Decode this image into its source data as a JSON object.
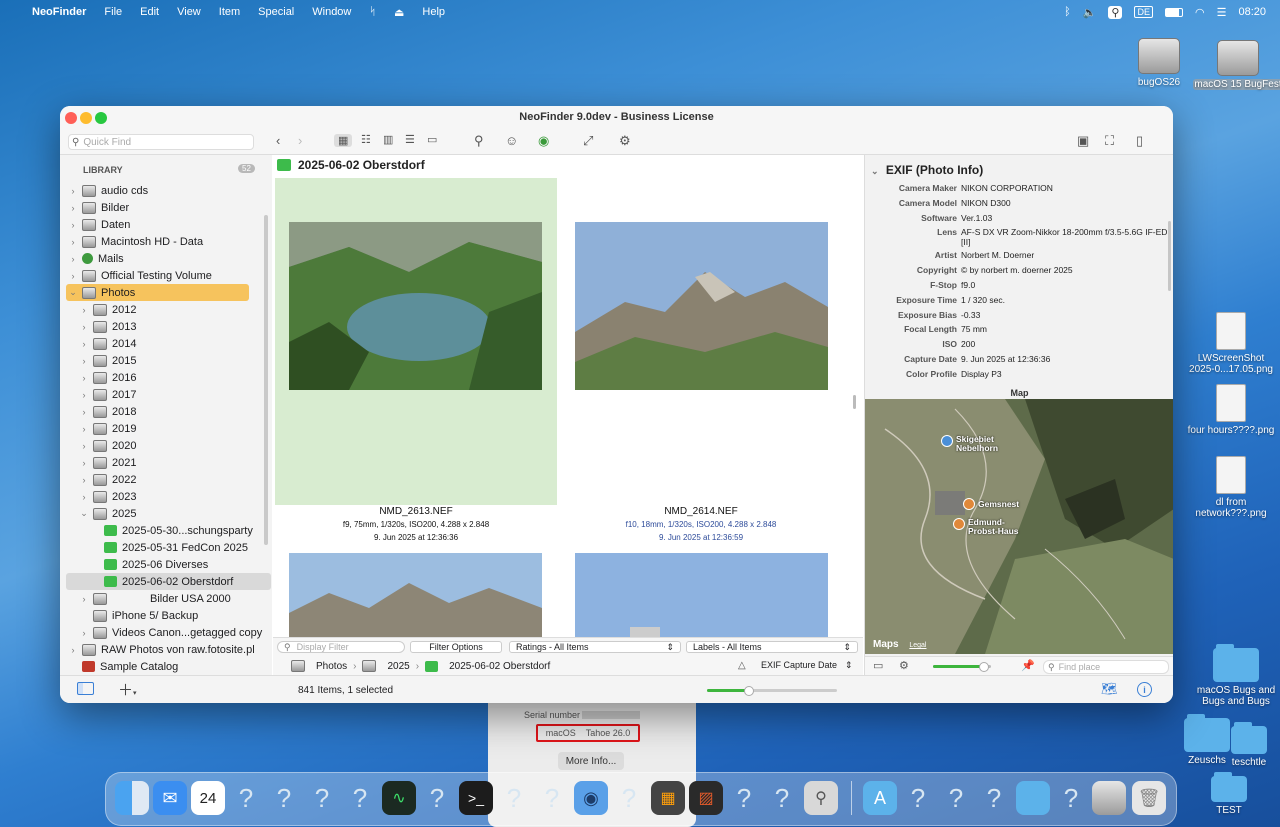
{
  "menubar": {
    "app": "NeoFinder",
    "items": [
      "File",
      "Edit",
      "View",
      "Item",
      "Special",
      "Window",
      "Help"
    ],
    "input_source": "DE",
    "clock": "08:20"
  },
  "desktop": {
    "icons": [
      {
        "label": "bugOS26",
        "type": "disk"
      },
      {
        "label": "macOS 15 BugFest",
        "type": "disk"
      },
      {
        "label": "LWScreenShot 2025-0...17.05.png",
        "type": "doc"
      },
      {
        "label": "four hours????.png",
        "type": "doc"
      },
      {
        "label": "dl from network???.png",
        "type": "doc"
      },
      {
        "label": "macOS Bugs and Bugs and Bugs",
        "type": "folder"
      },
      {
        "label": "Zeuschs",
        "type": "folder"
      },
      {
        "label": "teschtle",
        "type": "folder"
      },
      {
        "label": "TEST",
        "type": "folder"
      }
    ]
  },
  "about_window": {
    "serial_label": "Serial number",
    "macos_label": "macOS",
    "macos_version": "Tahoe 26.0",
    "more_info": "More Info..."
  },
  "window": {
    "title": "NeoFinder 9.0dev - Business License",
    "quick_find_placeholder": "Quick Find",
    "library_label": "LIBRARY",
    "library_count": "52",
    "sidebar": [
      {
        "label": "audio cds",
        "level": 0,
        "chev": "›",
        "icon": "disk"
      },
      {
        "label": "Bilder",
        "level": 0,
        "chev": "›",
        "icon": "disk"
      },
      {
        "label": "Daten",
        "level": 0,
        "chev": "›",
        "icon": "disk"
      },
      {
        "label": "Macintosh HD - Data",
        "level": 0,
        "chev": "›",
        "icon": "disk"
      },
      {
        "label": "Mails",
        "level": 0,
        "chev": "›",
        "icon": "mail"
      },
      {
        "label": "Official Testing Volume",
        "level": 0,
        "chev": "›",
        "icon": "disk"
      },
      {
        "label": "Photos",
        "level": 0,
        "chev": "⌄",
        "icon": "disk",
        "selected": "yes"
      },
      {
        "label": "2012",
        "level": 1,
        "chev": "›",
        "icon": "disk"
      },
      {
        "label": "2013",
        "level": 1,
        "chev": "›",
        "icon": "disk"
      },
      {
        "label": "2014",
        "level": 1,
        "chev": "›",
        "icon": "disk"
      },
      {
        "label": "2015",
        "level": 1,
        "chev": "›",
        "icon": "disk"
      },
      {
        "label": "2016",
        "level": 1,
        "chev": "›",
        "icon": "disk"
      },
      {
        "label": "2017",
        "level": 1,
        "chev": "›",
        "icon": "disk"
      },
      {
        "label": "2018",
        "level": 1,
        "chev": "›",
        "icon": "disk"
      },
      {
        "label": "2019",
        "level": 1,
        "chev": "›",
        "icon": "disk"
      },
      {
        "label": "2020",
        "level": 1,
        "chev": "›",
        "icon": "disk"
      },
      {
        "label": "2021",
        "level": 1,
        "chev": "›",
        "icon": "disk"
      },
      {
        "label": "2022",
        "level": 1,
        "chev": "›",
        "icon": "disk"
      },
      {
        "label": "2023",
        "level": 1,
        "chev": "›",
        "icon": "disk"
      },
      {
        "label": "2025",
        "level": 1,
        "chev": "⌄",
        "icon": "disk"
      },
      {
        "label": "2025-05-30...schungsparty",
        "level": 2,
        "chev": "",
        "icon": "gf"
      },
      {
        "label": "2025-05-31 FedCon 2025",
        "level": 2,
        "chev": "",
        "icon": "gf"
      },
      {
        "label": "2025-06 Diverses",
        "level": 2,
        "chev": "",
        "icon": "gf"
      },
      {
        "label": "2025-06-02 Oberstdorf",
        "level": 2,
        "chev": "",
        "icon": "gf",
        "current": "yes"
      },
      {
        "label": "Bilder USA 2000",
        "level": 1,
        "chev": "›",
        "icon": "disk",
        "indent": "yes"
      },
      {
        "label": "iPhone 5/ Backup",
        "level": 1,
        "chev": "",
        "icon": "disk"
      },
      {
        "label": "Videos Canon...getagged copy",
        "level": 1,
        "chev": "›",
        "icon": "disk"
      },
      {
        "label": "RAW Photos von raw.fotosite.pl",
        "level": 0,
        "chev": "›",
        "icon": "disk"
      },
      {
        "label": "Sample Catalog",
        "level": 0,
        "chev": "",
        "icon": "cat"
      }
    ],
    "folder_title": "2025-06-02 Oberstdorf",
    "photos": [
      {
        "name": "NMD_2613.NEF",
        "meta": "f9, 75mm, 1/320s, ISO200, 4.288 x 2.848",
        "date": "9. Jun 2025 at 12:36:36",
        "selected": "yes"
      },
      {
        "name": "NMD_2614.NEF",
        "meta": "f10, 18mm, 1/320s, ISO200, 4.288 x 2.848",
        "date": "9. Jun 2025 at 12:36:59",
        "selected": "no"
      }
    ],
    "display_filter_placeholder": "Display Filter",
    "filter_options": "Filter Options",
    "ratings": "Ratings - All Items",
    "labels": "Labels - All Items",
    "path": [
      "Photos",
      "2025",
      "2025-06-02 Oberstdorf"
    ],
    "sort": "EXIF Capture Date",
    "status": "841 Items, 1 selected",
    "exif": {
      "title": "EXIF (Photo Info)",
      "rows": [
        {
          "k": "Camera Maker",
          "v": "NIKON CORPORATION"
        },
        {
          "k": "Camera Model",
          "v": "NIKON D300"
        },
        {
          "k": "Software",
          "v": "Ver.1.03"
        },
        {
          "k": "Lens",
          "v": "AF-S DX VR Zoom-Nikkor 18-200mm f/3.5-5.6G IF-ED [II]"
        },
        {
          "k": "Artist",
          "v": "Norbert M. Doerner"
        },
        {
          "k": "Copyright",
          "v": "© by norbert m. doerner 2025"
        },
        {
          "k": "F-Stop",
          "v": "f9.0"
        },
        {
          "k": "Exposure Time",
          "v": "1 / 320 sec."
        },
        {
          "k": "Exposure Bias",
          "v": "-0.33"
        },
        {
          "k": "Focal Length",
          "v": "75 mm"
        },
        {
          "k": "ISO",
          "v": "200"
        },
        {
          "k": "Capture Date",
          "v": "9. Jun 2025 at 12:36:36"
        },
        {
          "k": "Color Profile",
          "v": "Display P3"
        }
      ]
    },
    "map": {
      "label": "Map",
      "places": [
        "Skigebiet Nebelhorn",
        "Gemsnest",
        "Edmund-Probst-Haus"
      ],
      "brand": "Maps",
      "legal": "Legal",
      "find_placeholder": "Find place"
    }
  }
}
